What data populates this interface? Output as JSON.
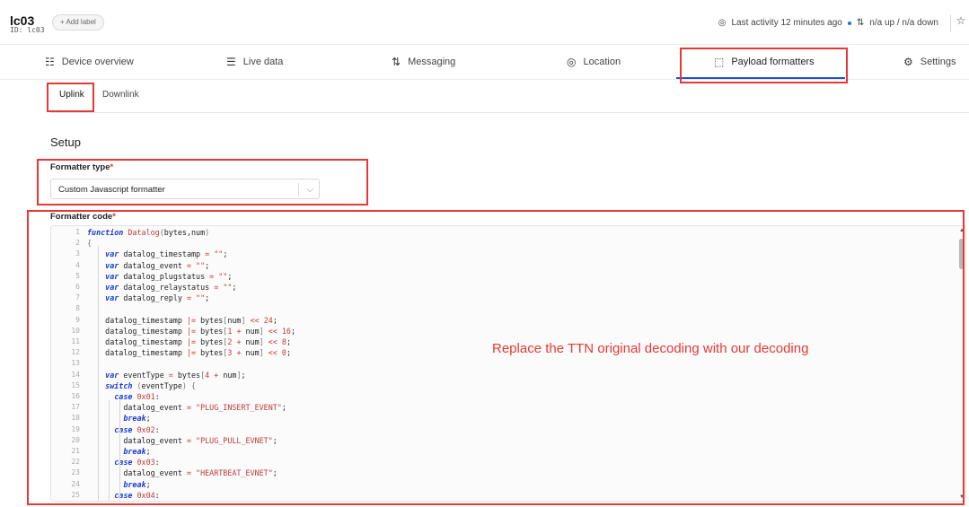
{
  "device": {
    "title": "lc03",
    "id": "ID: lc03",
    "add_label": "+ Add label"
  },
  "header": {
    "activity": "Last activity 12 minutes ago",
    "traffic": "n/a up / n/a down"
  },
  "tabs": [
    {
      "label": "Device overview",
      "icon": "grid-icon"
    },
    {
      "label": "Live data",
      "icon": "list-icon"
    },
    {
      "label": "Messaging",
      "icon": "arrows-updown-icon"
    },
    {
      "label": "Location",
      "icon": "location-pin-icon"
    },
    {
      "label": "Payload formatters",
      "icon": "formatter-icon"
    },
    {
      "label": "Settings",
      "icon": "gear-icon"
    }
  ],
  "active_tab": "Payload formatters",
  "subtabs": [
    {
      "label": "Uplink"
    },
    {
      "label": "Downlink"
    }
  ],
  "setup": {
    "title": "Setup",
    "formatter_type_label": "Formatter type",
    "formatter_type_value": "Custom Javascript formatter",
    "formatter_code_label": "Formatter code",
    "required_mark": "*"
  },
  "code_lines": [
    "function Datalog(bytes,num)",
    "{",
    "    var datalog_timestamp = \"\";",
    "    var datalog_event = \"\";",
    "    var datalog_plugstatus = \"\";",
    "    var datalog_relaystatus = \"\";",
    "    var datalog_reply = \"\";",
    "",
    "    datalog_timestamp |= bytes[num] << 24;",
    "    datalog_timestamp |= bytes[1 + num] << 16;",
    "    datalog_timestamp |= bytes[2 + num] << 8;",
    "    datalog_timestamp |= bytes[3 + num] << 0;",
    "",
    "    var eventType = bytes[4 + num];",
    "    switch (eventType) {",
    "      case 0x01:",
    "        datalog_event = \"PLUG_INSERT_EVENT\";",
    "        break;",
    "      case 0x02:",
    "        datalog_event = \"PLUG_PULL_EVNET\";",
    "        break;",
    "      case 0x03:",
    "        datalog_event = \"HEARTBEAT_EVNET\";",
    "        break;",
    "      case 0x04:"
  ],
  "annotation": "Replace the TTN original decoding with our decoding",
  "colors": {
    "accent": "#1a4fd6",
    "annotation_red": "#e53935",
    "keyword": "#1a3ad6",
    "string": "#c13a3a"
  }
}
